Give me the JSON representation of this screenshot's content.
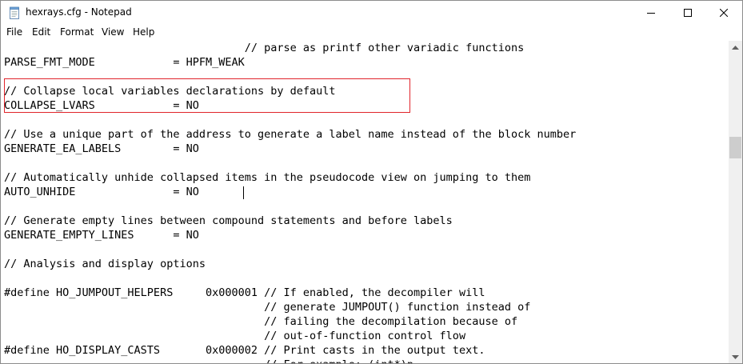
{
  "window": {
    "title": "hexrays.cfg - Notepad"
  },
  "menu": [
    "File",
    "Edit",
    "Format",
    "View",
    "Help"
  ],
  "editor": {
    "lines": [
      "                                     // parse as printf other variadic functions",
      "PARSE_FMT_MODE            = HPFM_WEAK",
      "",
      "// Collapse local variables declarations by default",
      "COLLAPSE_LVARS            = NO",
      "",
      "// Use a unique part of the address to generate a label name instead of the block number",
      "GENERATE_EA_LABELS        = NO",
      "",
      "// Automatically unhide collapsed items in the pseudocode view on jumping to them",
      "AUTO_UNHIDE               = NO",
      "",
      "// Generate empty lines between compound statements and before labels",
      "GENERATE_EMPTY_LINES      = NO",
      "",
      "// Analysis and display options",
      "",
      "#define HO_JUMPOUT_HELPERS     0x000001 // If enabled, the decompiler will",
      "                                        // generate JUMPOUT() function instead of",
      "                                        // failing the decompilation because of",
      "                                        // out-of-function control flow",
      "#define HO_DISPLAY_CASTS       0x000002 // Print casts in the output text.",
      "                                        // For example: (int*)p"
    ]
  },
  "colors": {
    "highlight_border": "#e0242b",
    "scrollbar_track": "#f0f0f0",
    "scrollbar_thumb": "#cdcdcd"
  }
}
